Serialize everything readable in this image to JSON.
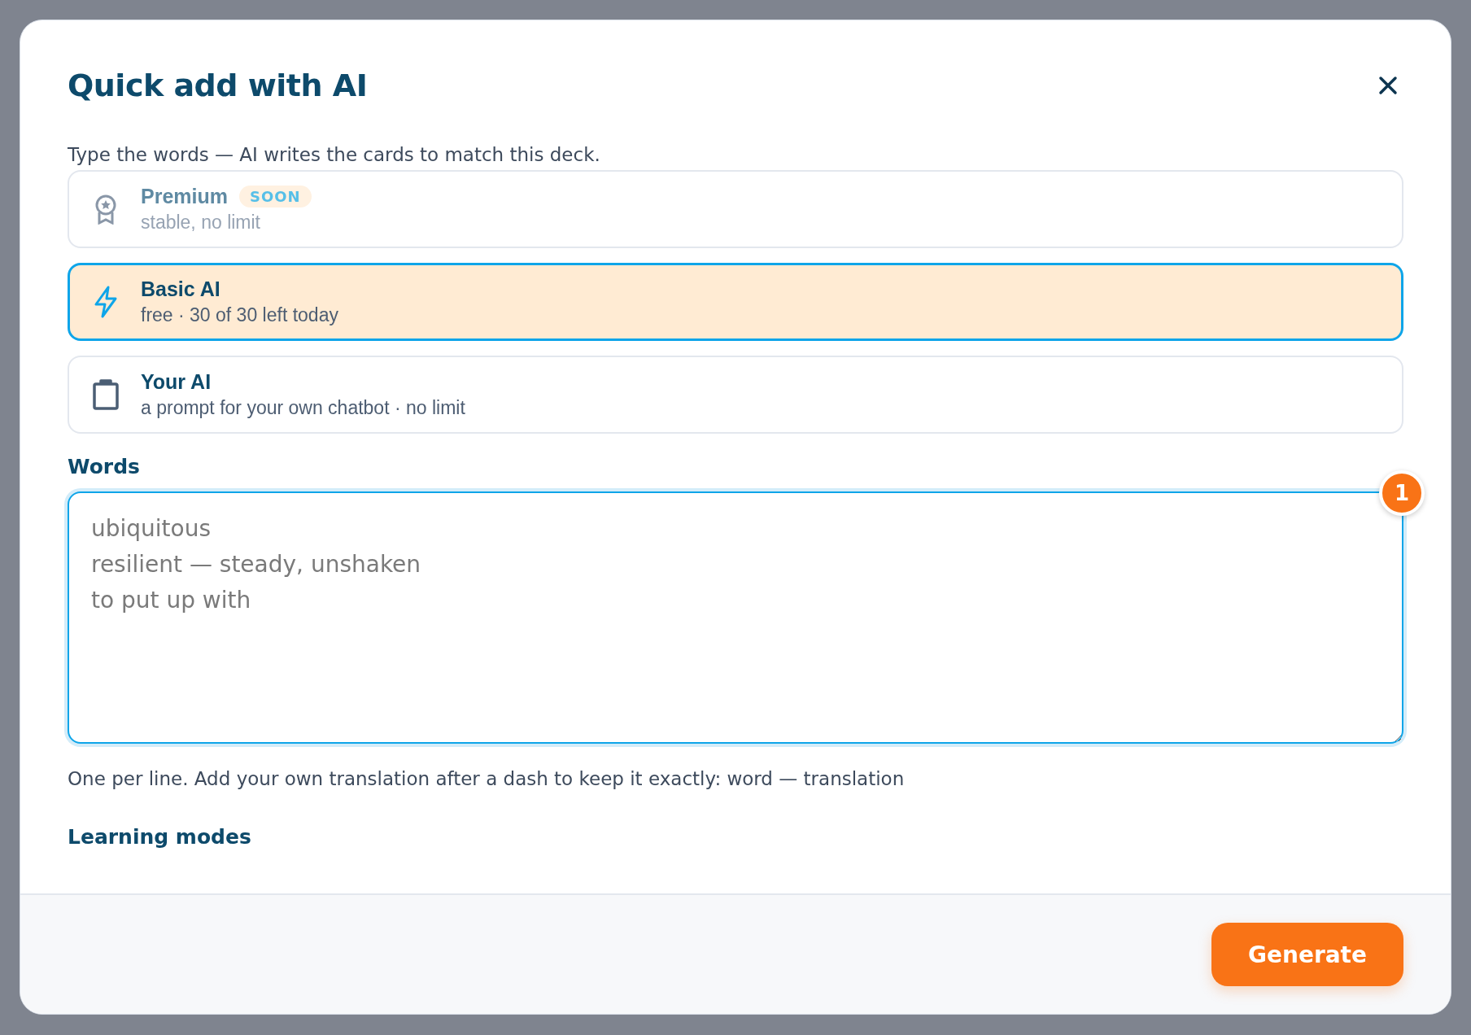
{
  "dialog": {
    "title": "Quick add with AI",
    "intro": "Type the words — AI writes the cards to match this deck."
  },
  "options": [
    {
      "kind": "award",
      "title": "Premium",
      "badge": "SOON",
      "subtitle": "stable, no limit",
      "selected": false,
      "disabled": true
    },
    {
      "kind": "bolt",
      "title": "Basic AI",
      "subtitle": "free · 30 of 30 left today",
      "selected": true,
      "disabled": false
    },
    {
      "kind": "clipboard",
      "title": "Your AI",
      "subtitle": "a prompt for your own chatbot · no limit",
      "selected": false,
      "disabled": false
    }
  ],
  "words": {
    "label": "Words",
    "placeholder": "ubiquitous\nresilient — steady, unshaken\nto put up with",
    "step_badge": "1",
    "hint": "One per line. Add your own translation after a dash to keep it exactly: word — translation"
  },
  "learning_modes": {
    "label": "Learning modes"
  },
  "footer": {
    "button": "Generate"
  }
}
